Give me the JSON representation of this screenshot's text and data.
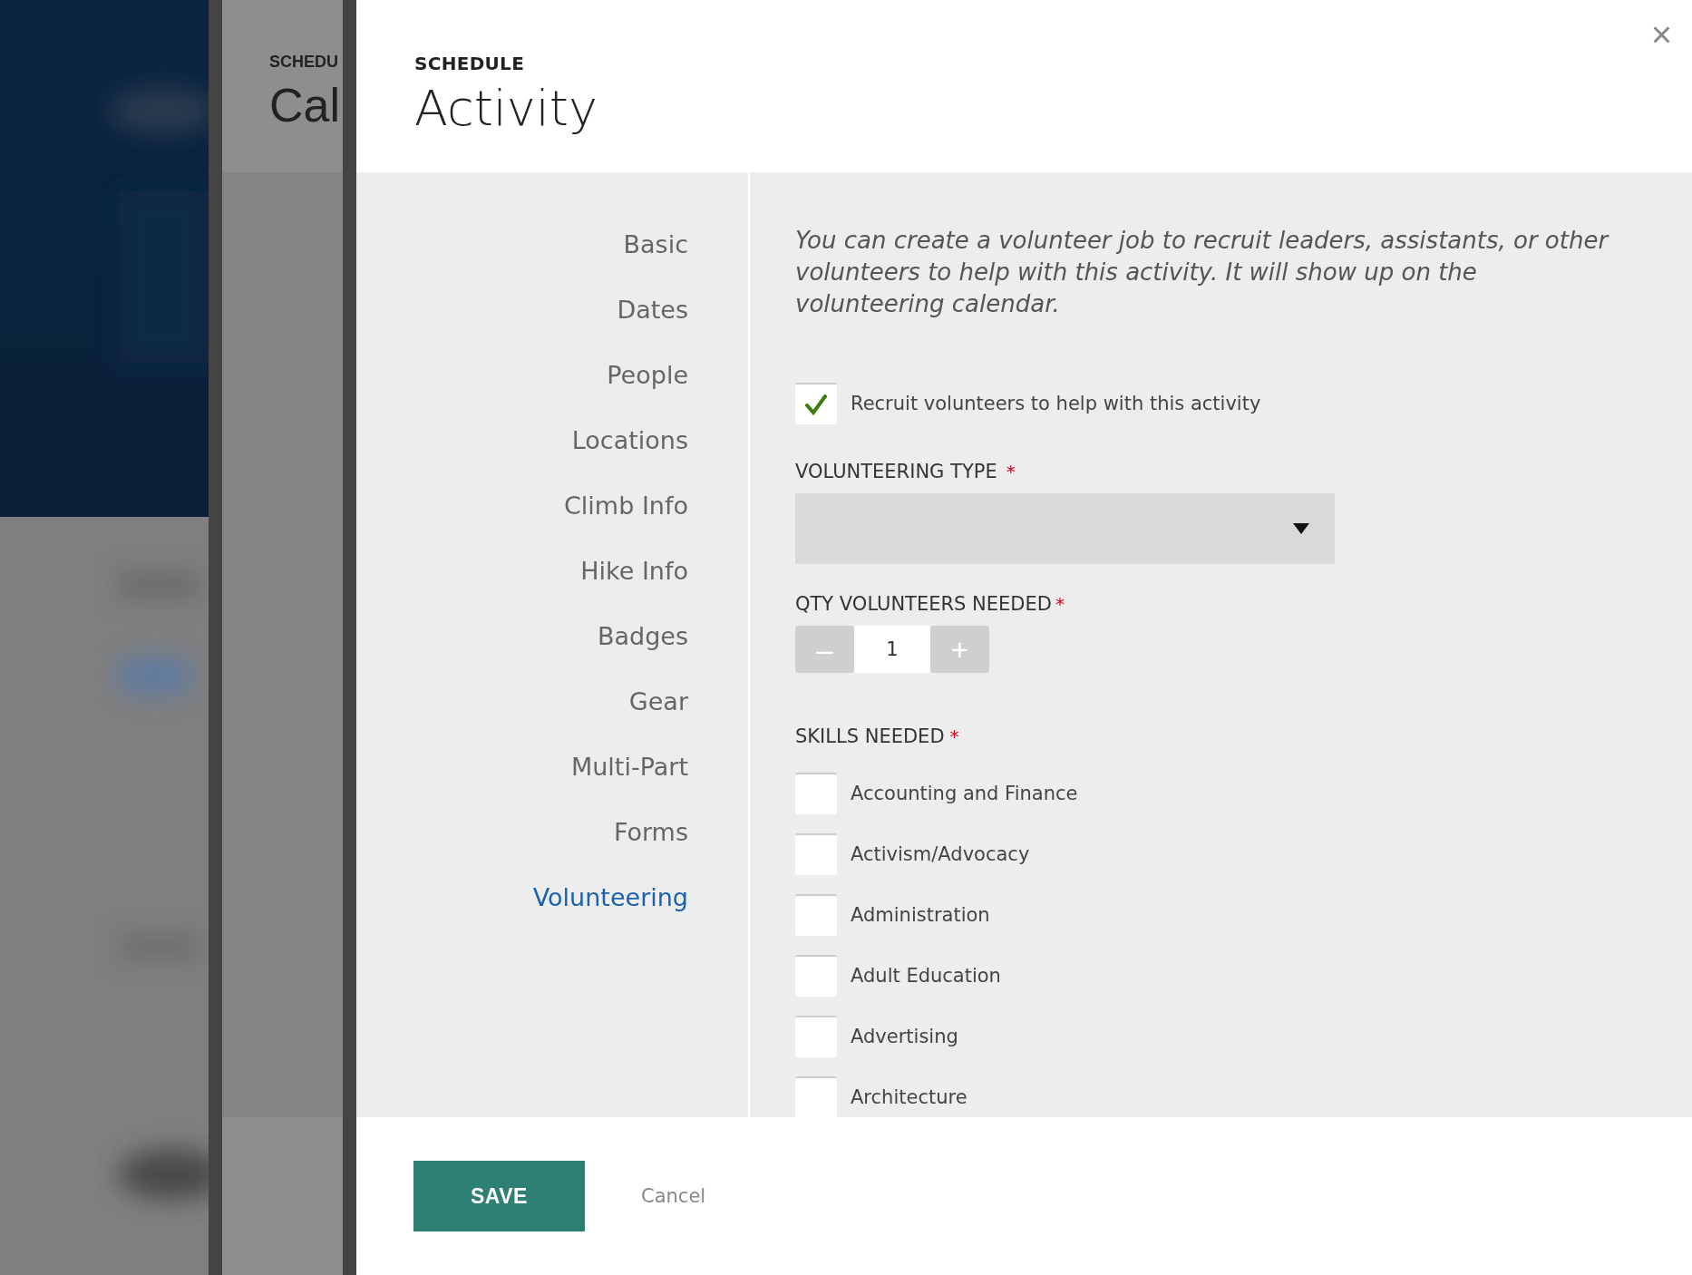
{
  "behind_panel": {
    "eyebrow": "SCHEDU",
    "title": "Cal"
  },
  "modal": {
    "eyebrow": "SCHEDULE",
    "title": "Activity",
    "close": "×"
  },
  "nav": [
    {
      "label": "Basic",
      "selected": false
    },
    {
      "label": "Dates",
      "selected": false
    },
    {
      "label": "People",
      "selected": false
    },
    {
      "label": "Locations",
      "selected": false
    },
    {
      "label": "Climb Info",
      "selected": false
    },
    {
      "label": "Hike Info",
      "selected": false
    },
    {
      "label": "Badges",
      "selected": false
    },
    {
      "label": "Gear",
      "selected": false
    },
    {
      "label": "Multi-Part",
      "selected": false
    },
    {
      "label": "Forms",
      "selected": false
    },
    {
      "label": "Volunteering",
      "selected": true
    }
  ],
  "intro": "You can create a volunteer job to recruit leaders, assistants, or other volunteers to help with this activity. It will show up on the volunteering calendar.",
  "recruit": {
    "label": "Recruit volunteers to help with this activity",
    "checked": true
  },
  "volunteering_type": {
    "label": "VOLUNTEERING TYPE",
    "required": "*"
  },
  "qty": {
    "label": "QTY VOLUNTEERS NEEDED",
    "required": "*",
    "minus": "–",
    "value": "1",
    "plus": "+"
  },
  "skills": {
    "label": "SKILLS NEEDED",
    "required": "*",
    "items": [
      {
        "label": "Accounting and Finance",
        "checked": false
      },
      {
        "label": "Activism/Advocacy",
        "checked": false
      },
      {
        "label": "Administration",
        "checked": false
      },
      {
        "label": "Adult Education",
        "checked": false
      },
      {
        "label": "Advertising",
        "checked": false
      },
      {
        "label": "Architecture",
        "checked": false
      }
    ]
  },
  "footer": {
    "save": "SAVE",
    "cancel": "Cancel"
  }
}
